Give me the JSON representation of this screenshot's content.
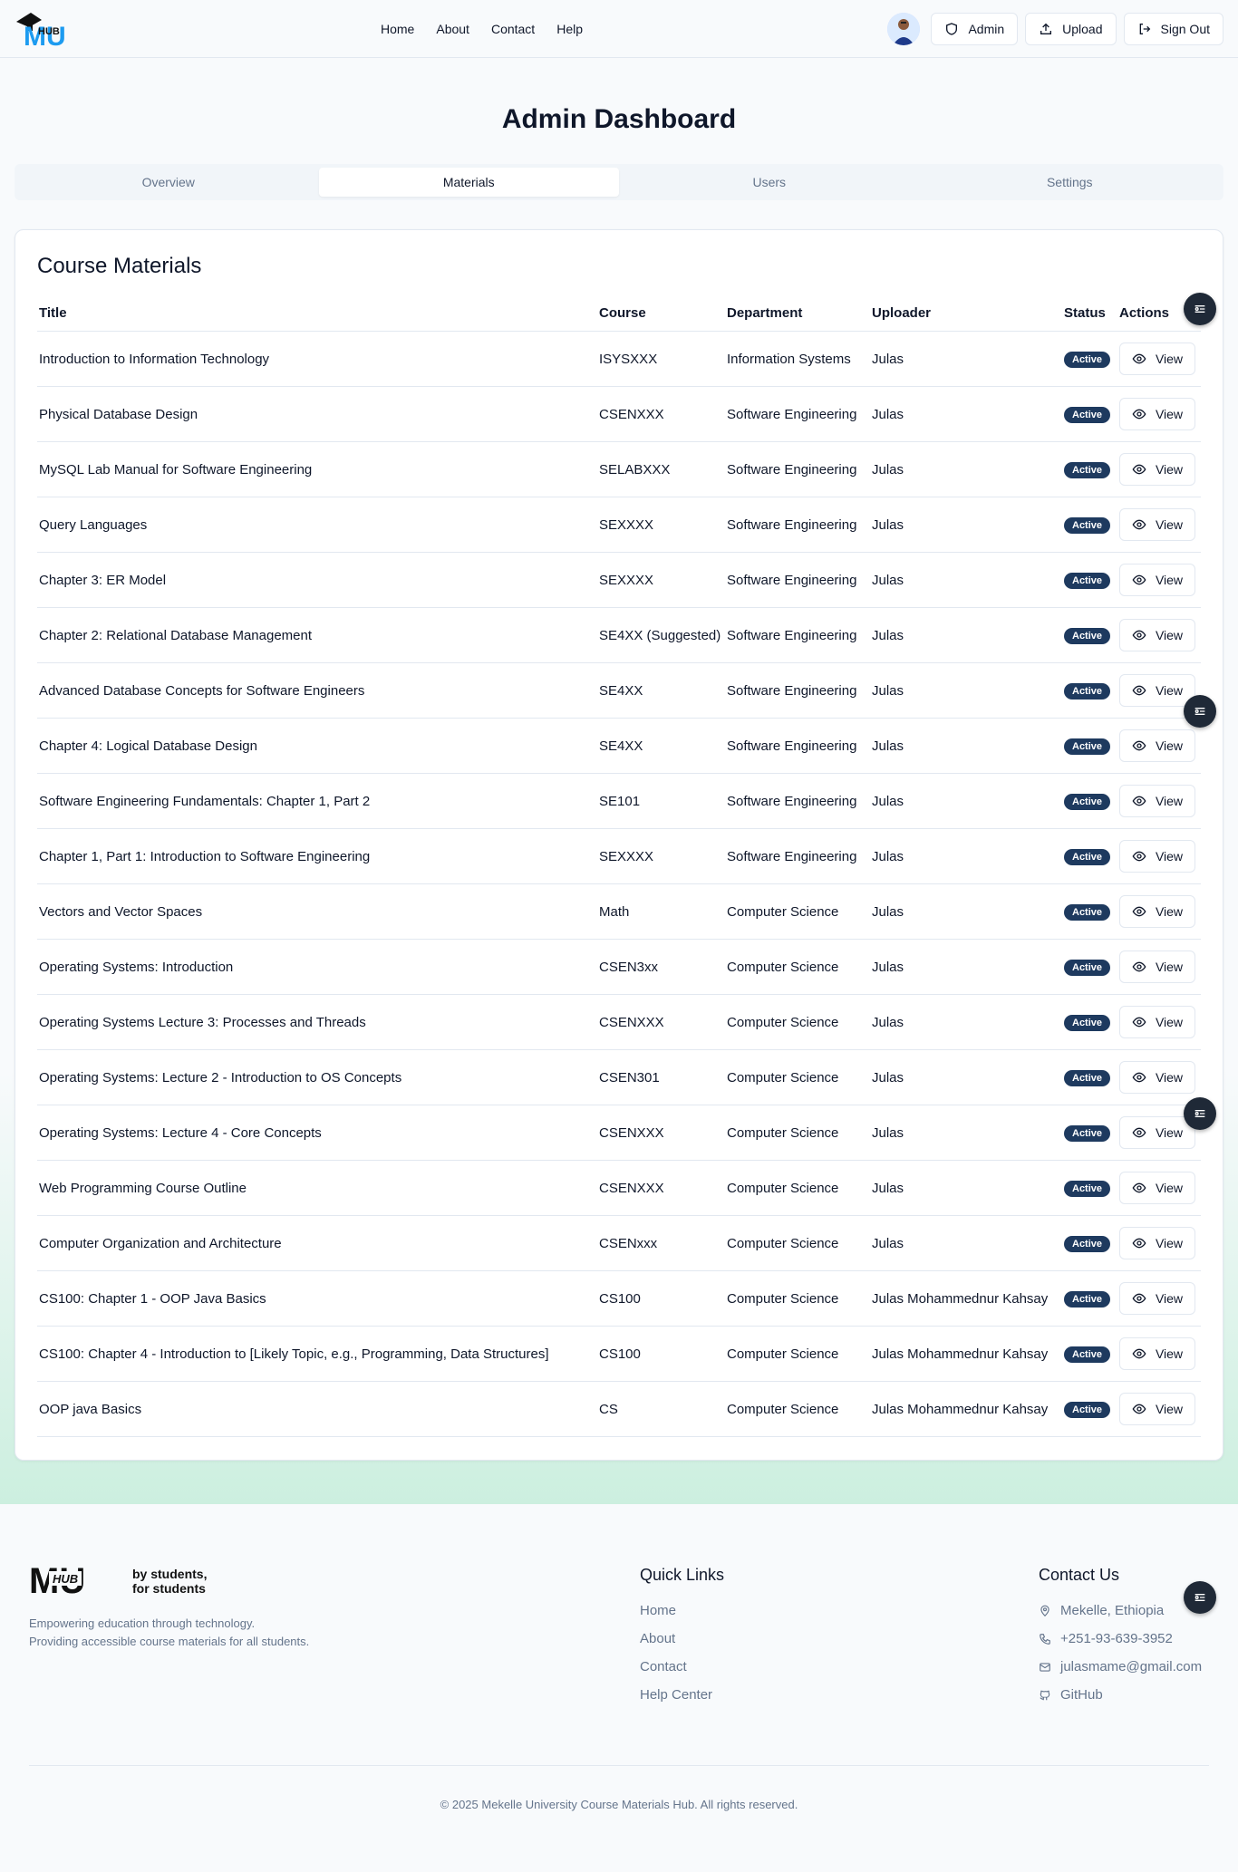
{
  "header": {
    "logo_text": "HUB",
    "nav": [
      "Home",
      "About",
      "Contact",
      "Help"
    ],
    "buttons": {
      "admin": "Admin",
      "upload": "Upload",
      "signout": "Sign Out"
    }
  },
  "page": {
    "title": "Admin Dashboard",
    "tabs": [
      "Overview",
      "Materials",
      "Users",
      "Settings"
    ],
    "active_tab": "Materials"
  },
  "materials": {
    "title": "Course Materials",
    "columns": [
      "Title",
      "Course",
      "Department",
      "Uploader",
      "Status",
      "Actions"
    ],
    "view_label": "View",
    "rows": [
      {
        "title": "Introduction to Information Technology",
        "course": "ISYSXXX",
        "department": "Information Systems",
        "uploader": "Julas",
        "status": "Active"
      },
      {
        "title": "Physical Database Design",
        "course": "CSENXXX",
        "department": "Software Engineering",
        "uploader": "Julas",
        "status": "Active"
      },
      {
        "title": "MySQL Lab Manual for Software Engineering",
        "course": "SELABXXX",
        "department": "Software Engineering",
        "uploader": "Julas",
        "status": "Active"
      },
      {
        "title": "Query Languages",
        "course": "SEXXXX",
        "department": "Software Engineering",
        "uploader": "Julas",
        "status": "Active"
      },
      {
        "title": "Chapter 3: ER Model",
        "course": "SEXXXX",
        "department": "Software Engineering",
        "uploader": "Julas",
        "status": "Active"
      },
      {
        "title": "Chapter 2: Relational Database Management",
        "course": "SE4XX (Suggested)",
        "department": "Software Engineering",
        "uploader": "Julas",
        "status": "Active"
      },
      {
        "title": "Advanced Database Concepts for Software Engineers",
        "course": "SE4XX",
        "department": "Software Engineering",
        "uploader": "Julas",
        "status": "Active"
      },
      {
        "title": "Chapter 4: Logical Database Design",
        "course": "SE4XX",
        "department": "Software Engineering",
        "uploader": "Julas",
        "status": "Active"
      },
      {
        "title": "Software Engineering Fundamentals: Chapter 1, Part 2",
        "course": "SE101",
        "department": "Software Engineering",
        "uploader": "Julas",
        "status": "Active"
      },
      {
        "title": "Chapter 1, Part 1: Introduction to Software Engineering",
        "course": "SEXXXX",
        "department": "Software Engineering",
        "uploader": "Julas",
        "status": "Active"
      },
      {
        "title": "Vectors and Vector Spaces",
        "course": "Math",
        "department": "Computer Science",
        "uploader": "Julas",
        "status": "Active"
      },
      {
        "title": "Operating Systems: Introduction",
        "course": "CSEN3xx",
        "department": "Computer Science",
        "uploader": "Julas",
        "status": "Active"
      },
      {
        "title": "Operating Systems Lecture 3: Processes and Threads",
        "course": "CSENXXX",
        "department": "Computer Science",
        "uploader": "Julas",
        "status": "Active"
      },
      {
        "title": "Operating Systems: Lecture 2 - Introduction to OS Concepts",
        "course": "CSEN301",
        "department": "Computer Science",
        "uploader": "Julas",
        "status": "Active"
      },
      {
        "title": "Operating Systems: Lecture 4 - Core Concepts",
        "course": "CSENXXX",
        "department": "Computer Science",
        "uploader": "Julas",
        "status": "Active"
      },
      {
        "title": "Web Programming Course Outline",
        "course": "CSENXXX",
        "department": "Computer Science",
        "uploader": "Julas",
        "status": "Active"
      },
      {
        "title": "Computer Organization and Architecture",
        "course": "CSENxxx",
        "department": "Computer Science",
        "uploader": "Julas",
        "status": "Active"
      },
      {
        "title": "CS100: Chapter 1 - OOP Java Basics",
        "course": "CS100",
        "department": "Computer Science",
        "uploader": "Julas Mohammednur Kahsay",
        "status": "Active"
      },
      {
        "title": "CS100: Chapter 4 - Introduction to [Likely Topic, e.g., Programming, Data Structures]",
        "course": "CS100",
        "department": "Computer Science",
        "uploader": "Julas Mohammednur Kahsay",
        "status": "Active"
      },
      {
        "title": "OOP java Basics",
        "course": "CS",
        "department": "Computer Science",
        "uploader": "Julas Mohammednur Kahsay",
        "status": "Active"
      }
    ]
  },
  "footer": {
    "logo_text": "HUB",
    "tagline_line1": "by students,",
    "tagline_line2": "for students",
    "desc_line1": "Empowering education through technology.",
    "desc_line2": "Providing accessible course materials for all students.",
    "quick_links_title": "Quick Links",
    "quick_links": [
      "Home",
      "About",
      "Contact",
      "Help Center"
    ],
    "contact_title": "Contact Us",
    "contact": {
      "location": "Mekelle, Ethiopia",
      "phone": "+251-93-639-3952",
      "email": "julasmame@gmail.com",
      "github": "GitHub"
    },
    "copyright": "© 2025 Mekelle University Course Materials Hub. All rights reserved."
  },
  "icons": {
    "admin": "shield-icon",
    "upload": "upload-icon",
    "signout": "logout-icon",
    "view": "eye-icon",
    "fab": "filter-toggle-icon",
    "location": "map-pin-icon",
    "phone": "phone-icon",
    "email": "mail-icon",
    "github": "github-icon"
  },
  "colors": {
    "accent": "#1e3a5f",
    "logo_blue": "#1d9bf0",
    "footer_gradient": "#ccefdf"
  }
}
